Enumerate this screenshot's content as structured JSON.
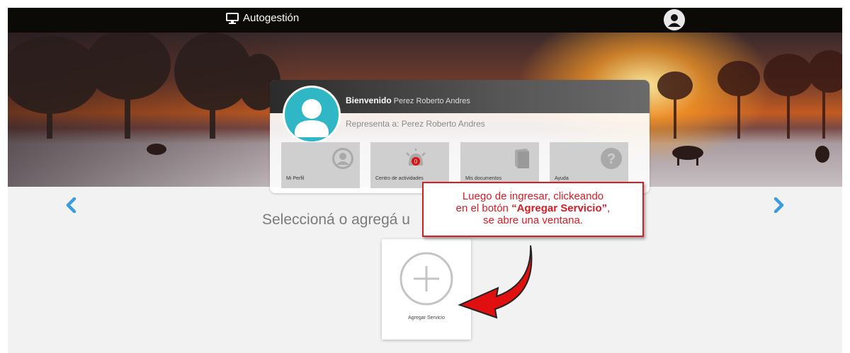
{
  "header": {
    "app_title": "Autogestión",
    "icons": [
      "monitor-icon",
      "user-avatar-icon"
    ]
  },
  "profile": {
    "welcome_label": "Bienvenido",
    "user_name": "Perez Roberto Andres",
    "represents": "Representa a: Perez Roberto Andres",
    "tiles": [
      {
        "label": "Mi Perfil",
        "icon": "user-circle-icon"
      },
      {
        "label": "Centro de actividades",
        "icon": "alarm-bell-icon",
        "badge": "0"
      },
      {
        "label": "Mis documentos",
        "icon": "book-icon"
      },
      {
        "label": "Ayuda",
        "icon": "help-icon"
      }
    ]
  },
  "main": {
    "heading": "Seleccioná o agregá u",
    "add_service_label": "Agregar Servicio"
  },
  "callout": {
    "line1": "Luego de ingresar, clickeando",
    "line2_pre": "en el botón ",
    "line2_em": "“Agregar Servicio”",
    "line2_post": ",",
    "line3": "se abre una ventana."
  },
  "colors": {
    "accent_teal": "#2fb7c6",
    "nav_arrow": "#3a9de0",
    "callout_red": "#d81c24",
    "badge_red": "#e01010"
  }
}
